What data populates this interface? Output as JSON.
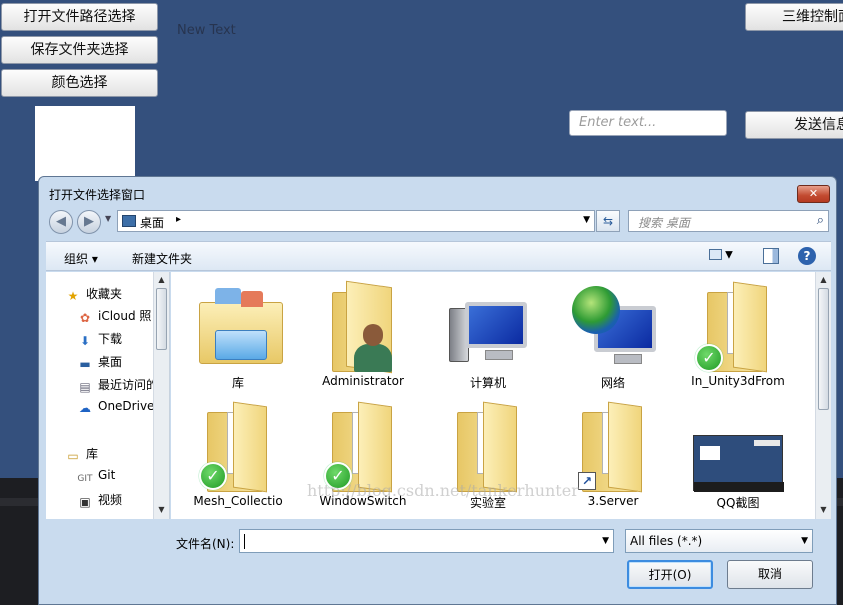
{
  "unity_buttons": {
    "open_path": "打开文件路径选择",
    "save_folder": "保存文件夹选择",
    "color_pick": "颜色选择",
    "three_d_control": "三维控制面",
    "send_info": "发送信息"
  },
  "new_text": "New Text",
  "input_placeholder": "Enter text...",
  "dialog": {
    "title": "打开文件选择窗口",
    "close_glyph": "✕",
    "address": {
      "location": "桌面",
      "separator": "▸"
    },
    "search_placeholder": "搜索 桌面",
    "toolbar": {
      "organize": "组织 ▾",
      "new_folder": "新建文件夹"
    },
    "nav": {
      "favorites": "收藏夹",
      "items": [
        "iCloud 照",
        "下载",
        "桌面",
        "最近访问的",
        "OneDrive"
      ],
      "library": "库",
      "library_items": [
        "Git",
        "视频"
      ]
    },
    "files": [
      {
        "label": "库"
      },
      {
        "label": "Administrator"
      },
      {
        "label": "计算机"
      },
      {
        "label": "网络"
      },
      {
        "label": "In_Unity3dFrom"
      },
      {
        "label": "Mesh_Collectio"
      },
      {
        "label": "WindowSwitch"
      },
      {
        "label": "实验室"
      },
      {
        "label": "3.Server"
      },
      {
        "label": "QQ截图"
      }
    ],
    "watermark": "http://blog.csdn.net/tankerhunter",
    "filename_label": "文件名(N):",
    "filename_value": "",
    "filter": "All files (*.*)",
    "open_button": "打开(O)",
    "cancel_button": "取消"
  },
  "icons": {
    "back": "search-arrow-left",
    "forward": "arrow-right",
    "refresh": "refresh",
    "search": "search",
    "help": "help"
  },
  "colors": {
    "unity_bg": "#34507d",
    "dialog_frame": "#c9dbee",
    "close_red": "#c24a30"
  }
}
